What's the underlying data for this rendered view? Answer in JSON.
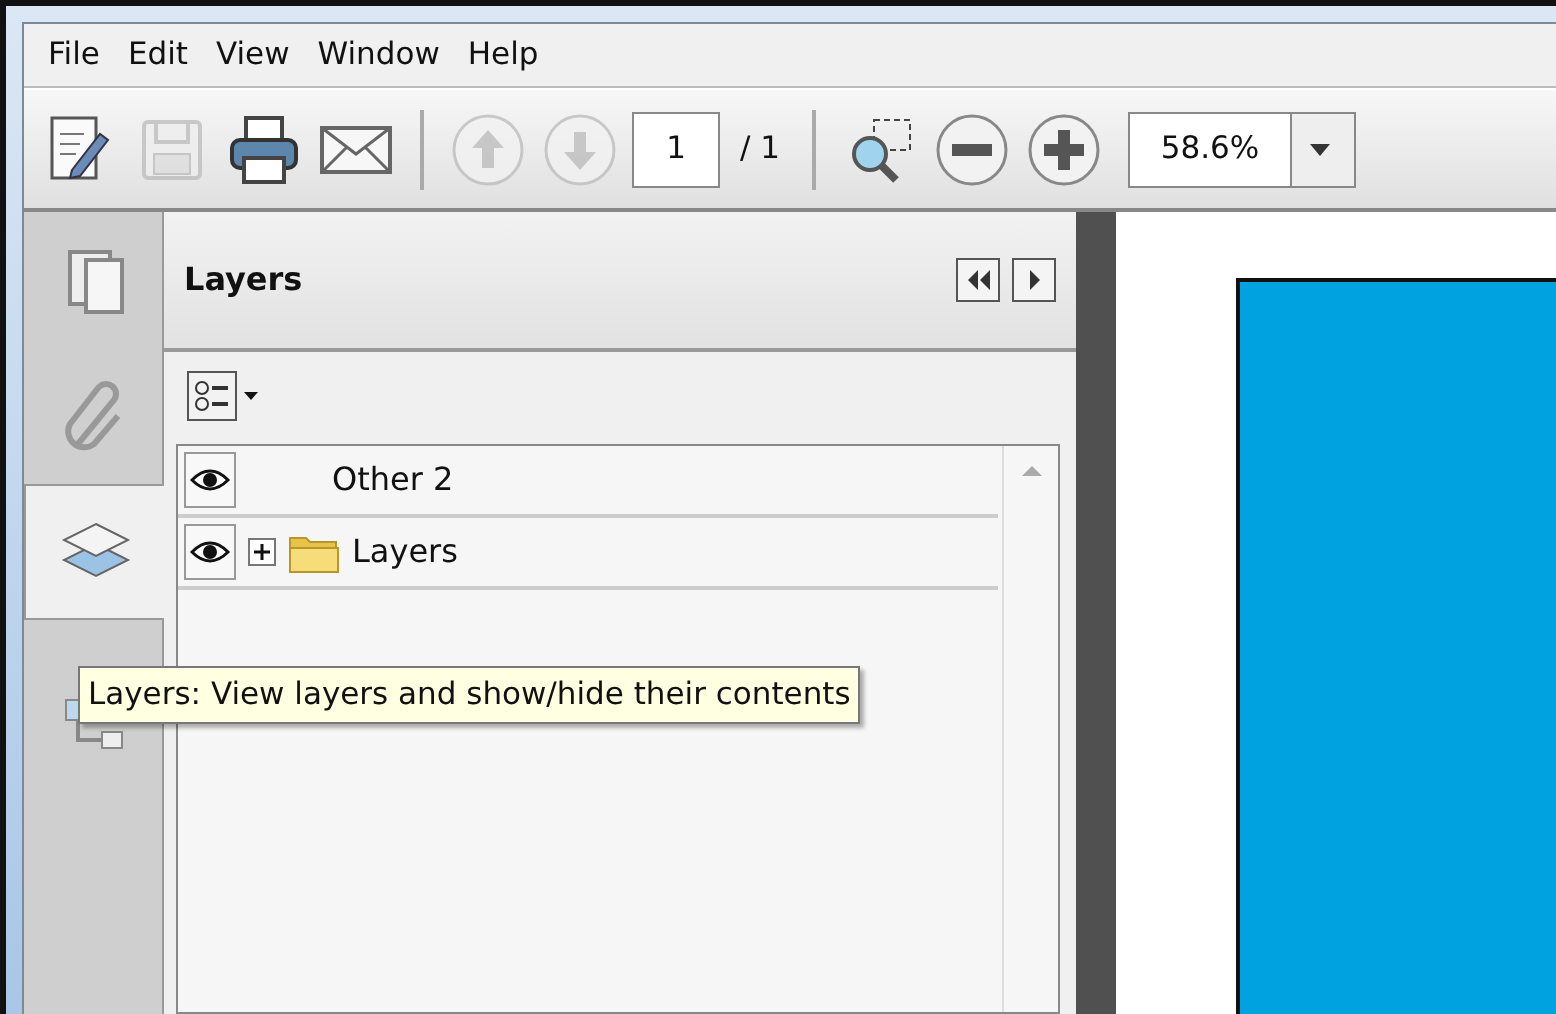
{
  "menu": [
    "File",
    "Edit",
    "View",
    "Window",
    "Help"
  ],
  "toolbar": {
    "tools": [
      {
        "kind": "edit",
        "disabled": false
      },
      {
        "kind": "save",
        "disabled": true
      },
      {
        "kind": "print",
        "disabled": false
      },
      {
        "kind": "mail",
        "disabled": false
      }
    ],
    "nav": [
      {
        "kind": "up",
        "disabled": true
      },
      {
        "kind": "down",
        "disabled": true
      }
    ],
    "page_field": {
      "value": "1"
    },
    "page_total": "/ 1",
    "zoom_tools": [
      {
        "kind": "marquee",
        "disabled": false
      },
      {
        "kind": "minus",
        "disabled": false
      },
      {
        "kind": "plus",
        "disabled": false
      }
    ],
    "zoom_field": {
      "value": "58.6%"
    }
  },
  "side_tabs": [
    {
      "kind": "pages",
      "selected": false
    },
    {
      "kind": "attachments",
      "selected": false
    },
    {
      "kind": "layers",
      "selected": true
    },
    {
      "kind": "model",
      "selected": false
    }
  ],
  "panel": {
    "title": "Layers",
    "layers": [
      {
        "kind": "layer",
        "name": "Other 2",
        "visible": true
      },
      {
        "kind": "folder",
        "name": "Layers",
        "visible": true,
        "expanded": false
      }
    ]
  },
  "tooltip": "Layers: View layers and show/hide their contents"
}
